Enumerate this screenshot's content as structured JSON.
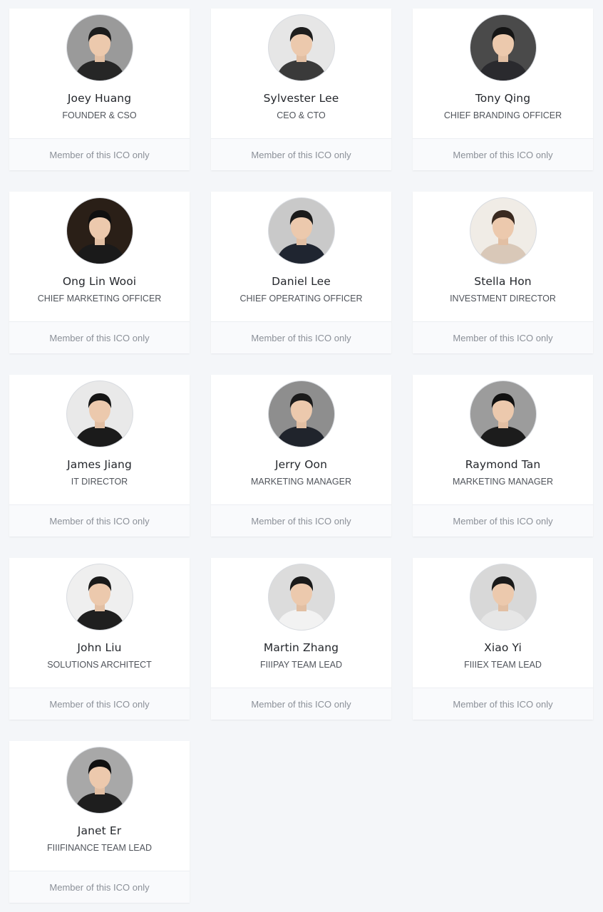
{
  "team": {
    "members": [
      {
        "name": "Joey Huang",
        "role": "FOUNDER & CSO",
        "footer": "Member of this ICO only",
        "photo_bg": "#9a9a9a",
        "hair": "#1c1c1c",
        "shirt": "#262626"
      },
      {
        "name": "Sylvester Lee",
        "role": "CEO & CTO",
        "footer": "Member of this ICO only",
        "photo_bg": "#e6e6e6",
        "hair": "#1e1e1e",
        "shirt": "#3a3a3a"
      },
      {
        "name": "Tony Qing",
        "role": "CHIEF BRANDING OFFICER",
        "footer": "Member of this ICO only",
        "photo_bg": "#4a4a4a",
        "hair": "#151515",
        "shirt": "#2a2a2e"
      },
      {
        "name": "Ong Lin Wooi",
        "role": "CHIEF MARKETING OFFICER",
        "footer": "Member of this ICO only",
        "photo_bg": "#2a1f17",
        "hair": "#0f0f0f",
        "shirt": "#1a1a1a"
      },
      {
        "name": "Daniel Lee",
        "role": "CHIEF OPERATING OFFICER",
        "footer": "Member of this ICO only",
        "photo_bg": "#c9c9c9",
        "hair": "#1a1a1a",
        "shirt": "#1f2530"
      },
      {
        "name": "Stella Hon",
        "role": "INVESTMENT DIRECTOR",
        "footer": "Member of this ICO only",
        "photo_bg": "#f0ece6",
        "hair": "#3a2a20",
        "shirt": "#d9c8b8"
      },
      {
        "name": "James Jiang",
        "role": "IT DIRECTOR",
        "footer": "Member of this ICO only",
        "photo_bg": "#e9e9e9",
        "hair": "#151515",
        "shirt": "#1b1b1b"
      },
      {
        "name": "Jerry Oon",
        "role": "MARKETING MANAGER",
        "footer": "Member of this ICO only",
        "photo_bg": "#8e8e8e",
        "hair": "#1b1b1b",
        "shirt": "#20242c"
      },
      {
        "name": "Raymond Tan",
        "role": "MARKETING MANAGER",
        "footer": "Member of this ICO only",
        "photo_bg": "#9c9c9c",
        "hair": "#111111",
        "shirt": "#1c1c1c"
      },
      {
        "name": "John Liu",
        "role": "SOLUTIONS ARCHITECT",
        "footer": "Member of this ICO only",
        "photo_bg": "#efefef",
        "hair": "#1a1a1a",
        "shirt": "#1f1f1f"
      },
      {
        "name": "Martin Zhang",
        "role": "FIIIPAY TEAM LEAD",
        "footer": "Member of this ICO only",
        "photo_bg": "#dcdcdc",
        "hair": "#1a1a1a",
        "shirt": "#f2f2f2"
      },
      {
        "name": "Xiao Yi",
        "role": "FIIIEX TEAM LEAD",
        "footer": "Member of this ICO only",
        "photo_bg": "#d8d8d8",
        "hair": "#1a1a1a",
        "shirt": "#e6e6e6"
      },
      {
        "name": "Janet Er",
        "role": "FIIIFINANCE TEAM LEAD",
        "footer": "Member of this ICO only",
        "photo_bg": "#a8a8a8",
        "hair": "#101010",
        "shirt": "#1e1e1e"
      }
    ]
  }
}
